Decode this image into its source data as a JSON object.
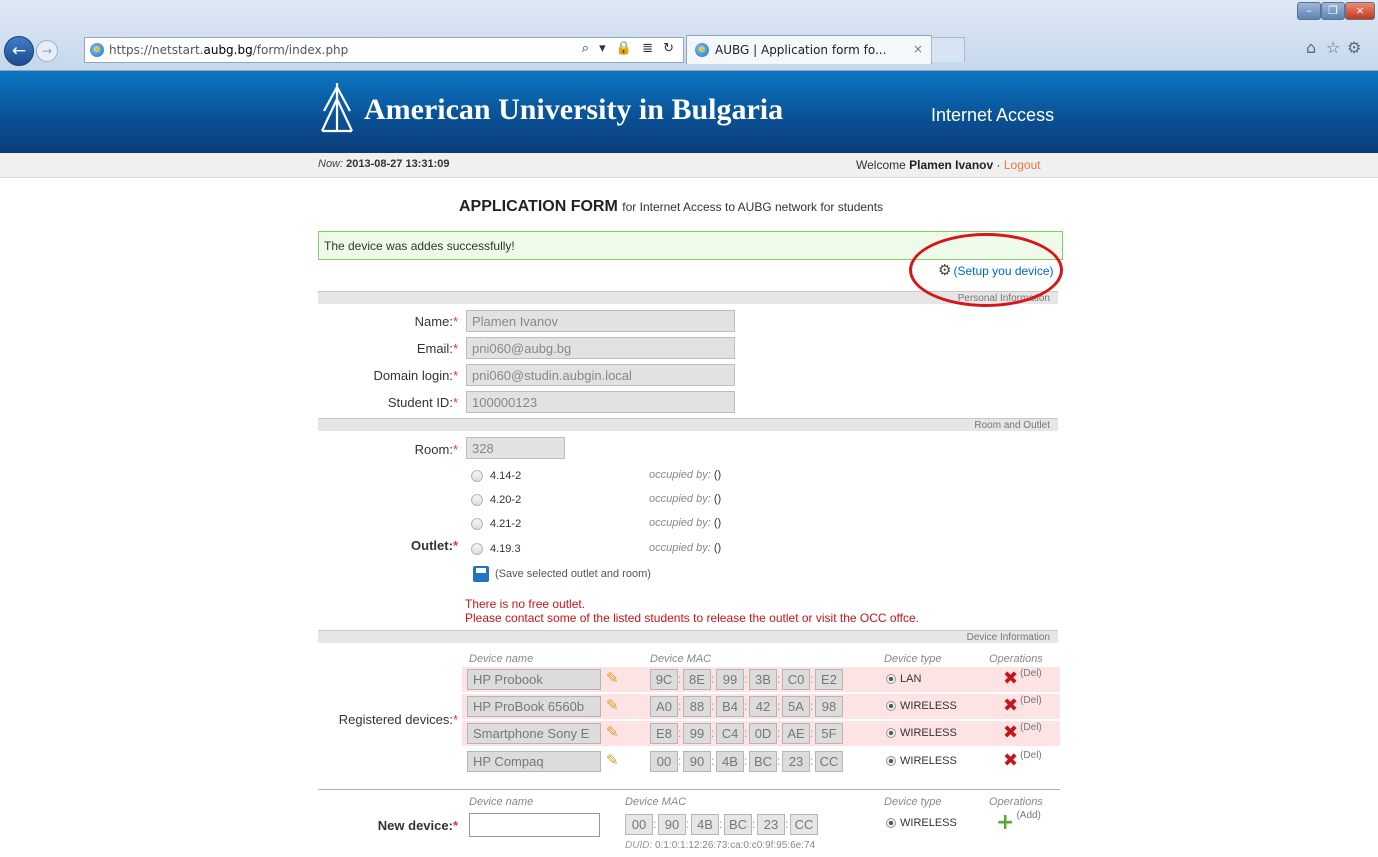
{
  "browser": {
    "url_prefix": "https://netstart.",
    "url_domain": "aubg.bg",
    "url_path": "/form/index.php",
    "addr_tools": "⌕ ▾ 🔒 ≣ ↻",
    "tab_title": "AUBG | Application form fo...",
    "tab_close": "×",
    "ie_glyph": "e",
    "back": "←",
    "forward": "→",
    "win_min": "–",
    "win_max": "❐",
    "win_close": "×",
    "home": "⌂",
    "star": "☆",
    "gear": "⚙"
  },
  "header": {
    "site_name": "American University in Bulgaria",
    "section": "Internet Access"
  },
  "status": {
    "now_label": "Now:",
    "now_value": "2013-08-27 13:31:09",
    "welcome_label": "Welcome",
    "user_name": "Plamen Ivanov",
    "separator": "·",
    "logout": "Logout"
  },
  "form": {
    "title_main": "APPLICATION FORM",
    "title_sub": "for Internet Access to AUBG network for students",
    "success_message": "The device was addes successfully!",
    "setup_link": "(Setup you device)",
    "setup_icon": "⚙",
    "required_mark": "*"
  },
  "sections": {
    "personal": "Personal Information",
    "room_outlet": "Room and Outlet",
    "device": "Device Information"
  },
  "personal": {
    "name_label": "Name:",
    "name_value": "Plamen Ivanov",
    "email_label": "Email:",
    "email_value": "pni060@aubg.bg",
    "domain_label": "Domain login:",
    "domain_value": "pni060@studin.aubgin.local",
    "student_id_label": "Student ID:",
    "student_id_value": "100000123"
  },
  "room": {
    "room_label": "Room:",
    "room_value": "328",
    "outlet_label": "Outlet:",
    "occupied_label": "occupied by:",
    "occupied_value": "()",
    "outlets": [
      "4.14-2",
      "4.20-2",
      "4.21-2",
      "4.19.3"
    ],
    "save_link": "(Save selected outlet and room)",
    "error_line1": "There is no free outlet.",
    "error_line2": "Please contact some of the listed students to release the outlet or visit the OCC offce."
  },
  "devices": {
    "registered_label": "Registered devices:",
    "col_name": "Device name",
    "col_mac": "Device MAC",
    "col_type": "Device type",
    "col_ops": "Operations",
    "del_label": "(Del)",
    "del_icon": "✖",
    "edit_icon": "✎",
    "rows": [
      {
        "name": "HP Probook",
        "mac": [
          "9C",
          "8E",
          "99",
          "3B",
          "C0",
          "E2"
        ],
        "type": "LAN"
      },
      {
        "name": "HP ProBook 6560b",
        "mac": [
          "A0",
          "88",
          "B4",
          "42",
          "5A",
          "98"
        ],
        "type": "WIRELESS"
      },
      {
        "name": "Smartphone Sony E",
        "mac": [
          "E8",
          "99",
          "C4",
          "0D",
          "AE",
          "5F"
        ],
        "type": "WIRELESS"
      },
      {
        "name": "HP Compaq",
        "mac": [
          "00",
          "90",
          "4B",
          "BC",
          "23",
          "CC"
        ],
        "type": "WIRELESS"
      }
    ]
  },
  "new_device": {
    "label": "New device:",
    "mac": [
      "00",
      "90",
      "4B",
      "BC",
      "23",
      "CC"
    ],
    "type": "WIRELESS",
    "add_label": "(Add)",
    "add_icon": "+",
    "duid_label": "DUID:",
    "duid_value": "0:1:0:1:12:26:73:ca:0:c0:9f:95:6e:74"
  }
}
